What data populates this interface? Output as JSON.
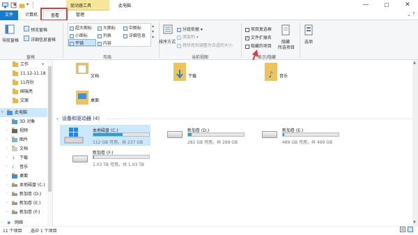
{
  "title_bar": {
    "tool_tab": "驱动器工具",
    "window_title": "此电脑",
    "minimize": "—",
    "maximize": "☐",
    "close": "✕"
  },
  "tabs": {
    "file": "文件",
    "computer": "计算机",
    "view": "查看",
    "manage": "管理"
  },
  "ribbon": {
    "pane": {
      "nav_pane": "导航窗格",
      "preview": "预览窗格",
      "details": "详细信息窗格",
      "group": "窗格"
    },
    "layout": {
      "items": [
        "超大图标",
        "大图标",
        "中图标",
        "小图标",
        "列表",
        "详细信息",
        "平铺",
        "内容"
      ],
      "group": "布局"
    },
    "current_view": {
      "sort": "排序方式",
      "group_by": "分组依据",
      "add_column": "添加列",
      "fit_columns": "将所有列调整为合适的大小",
      "group": "当前视图"
    },
    "show_hide": {
      "item_checkboxes": "项目复选框",
      "file_extensions": "文件扩展名",
      "hidden_items": "隐藏的项目",
      "hide_selected": "隐藏",
      "hide_selected_2": "所选项目",
      "options": "选项",
      "group": "显示/隐藏",
      "checked": {
        "item_checkboxes": false,
        "file_extensions": true,
        "hidden_items": false
      }
    }
  },
  "nav": {
    "items": [
      {
        "label": "工作",
        "pin": "✦"
      },
      {
        "label": "11.12-11.18"
      },
      {
        "label": "11月份"
      },
      {
        "label": "国瑞亮"
      },
      {
        "label": "文案"
      },
      {
        "label": "此电脑"
      },
      {
        "label": "3D 对象"
      },
      {
        "label": "视频"
      },
      {
        "label": "图片"
      },
      {
        "label": "文档"
      },
      {
        "label": "下载"
      },
      {
        "label": "音乐"
      },
      {
        "label": "桌面"
      },
      {
        "label": "本地磁盘 (C:)"
      },
      {
        "label": "新加卷 (D:)"
      },
      {
        "label": "新加卷 (E:)"
      },
      {
        "label": "新加卷 (F:)"
      },
      {
        "label": "网络"
      }
    ]
  },
  "folders": {
    "docs": "文档",
    "downloads": "下载",
    "music": "音乐",
    "desktop": "桌面"
  },
  "devices": {
    "header": "设备和驱动器 (4)",
    "drives": [
      {
        "name": "本地磁盘 (C:)",
        "info": "112 GB 可用，共 237 GB",
        "used": 0.53
      },
      {
        "name": "新加卷 (D:)",
        "info": "281 GB 可用，共 299 GB",
        "used": 0.06
      },
      {
        "name": "新加卷 (E:)",
        "info": "489 GB 可用，共 499 GB",
        "used": 0.02
      },
      {
        "name": "新加卷 (F:)",
        "info": "1.03 TB 可用，共 1.03 TB",
        "used": 0.01
      }
    ]
  },
  "status": {
    "count": "11 个项目",
    "selected": "选中 1 个项目"
  },
  "colors": {
    "accent": "#1979ca",
    "highlight": "#cce8ff",
    "annotation": "#e23a3a",
    "bar": "#26a0da"
  }
}
